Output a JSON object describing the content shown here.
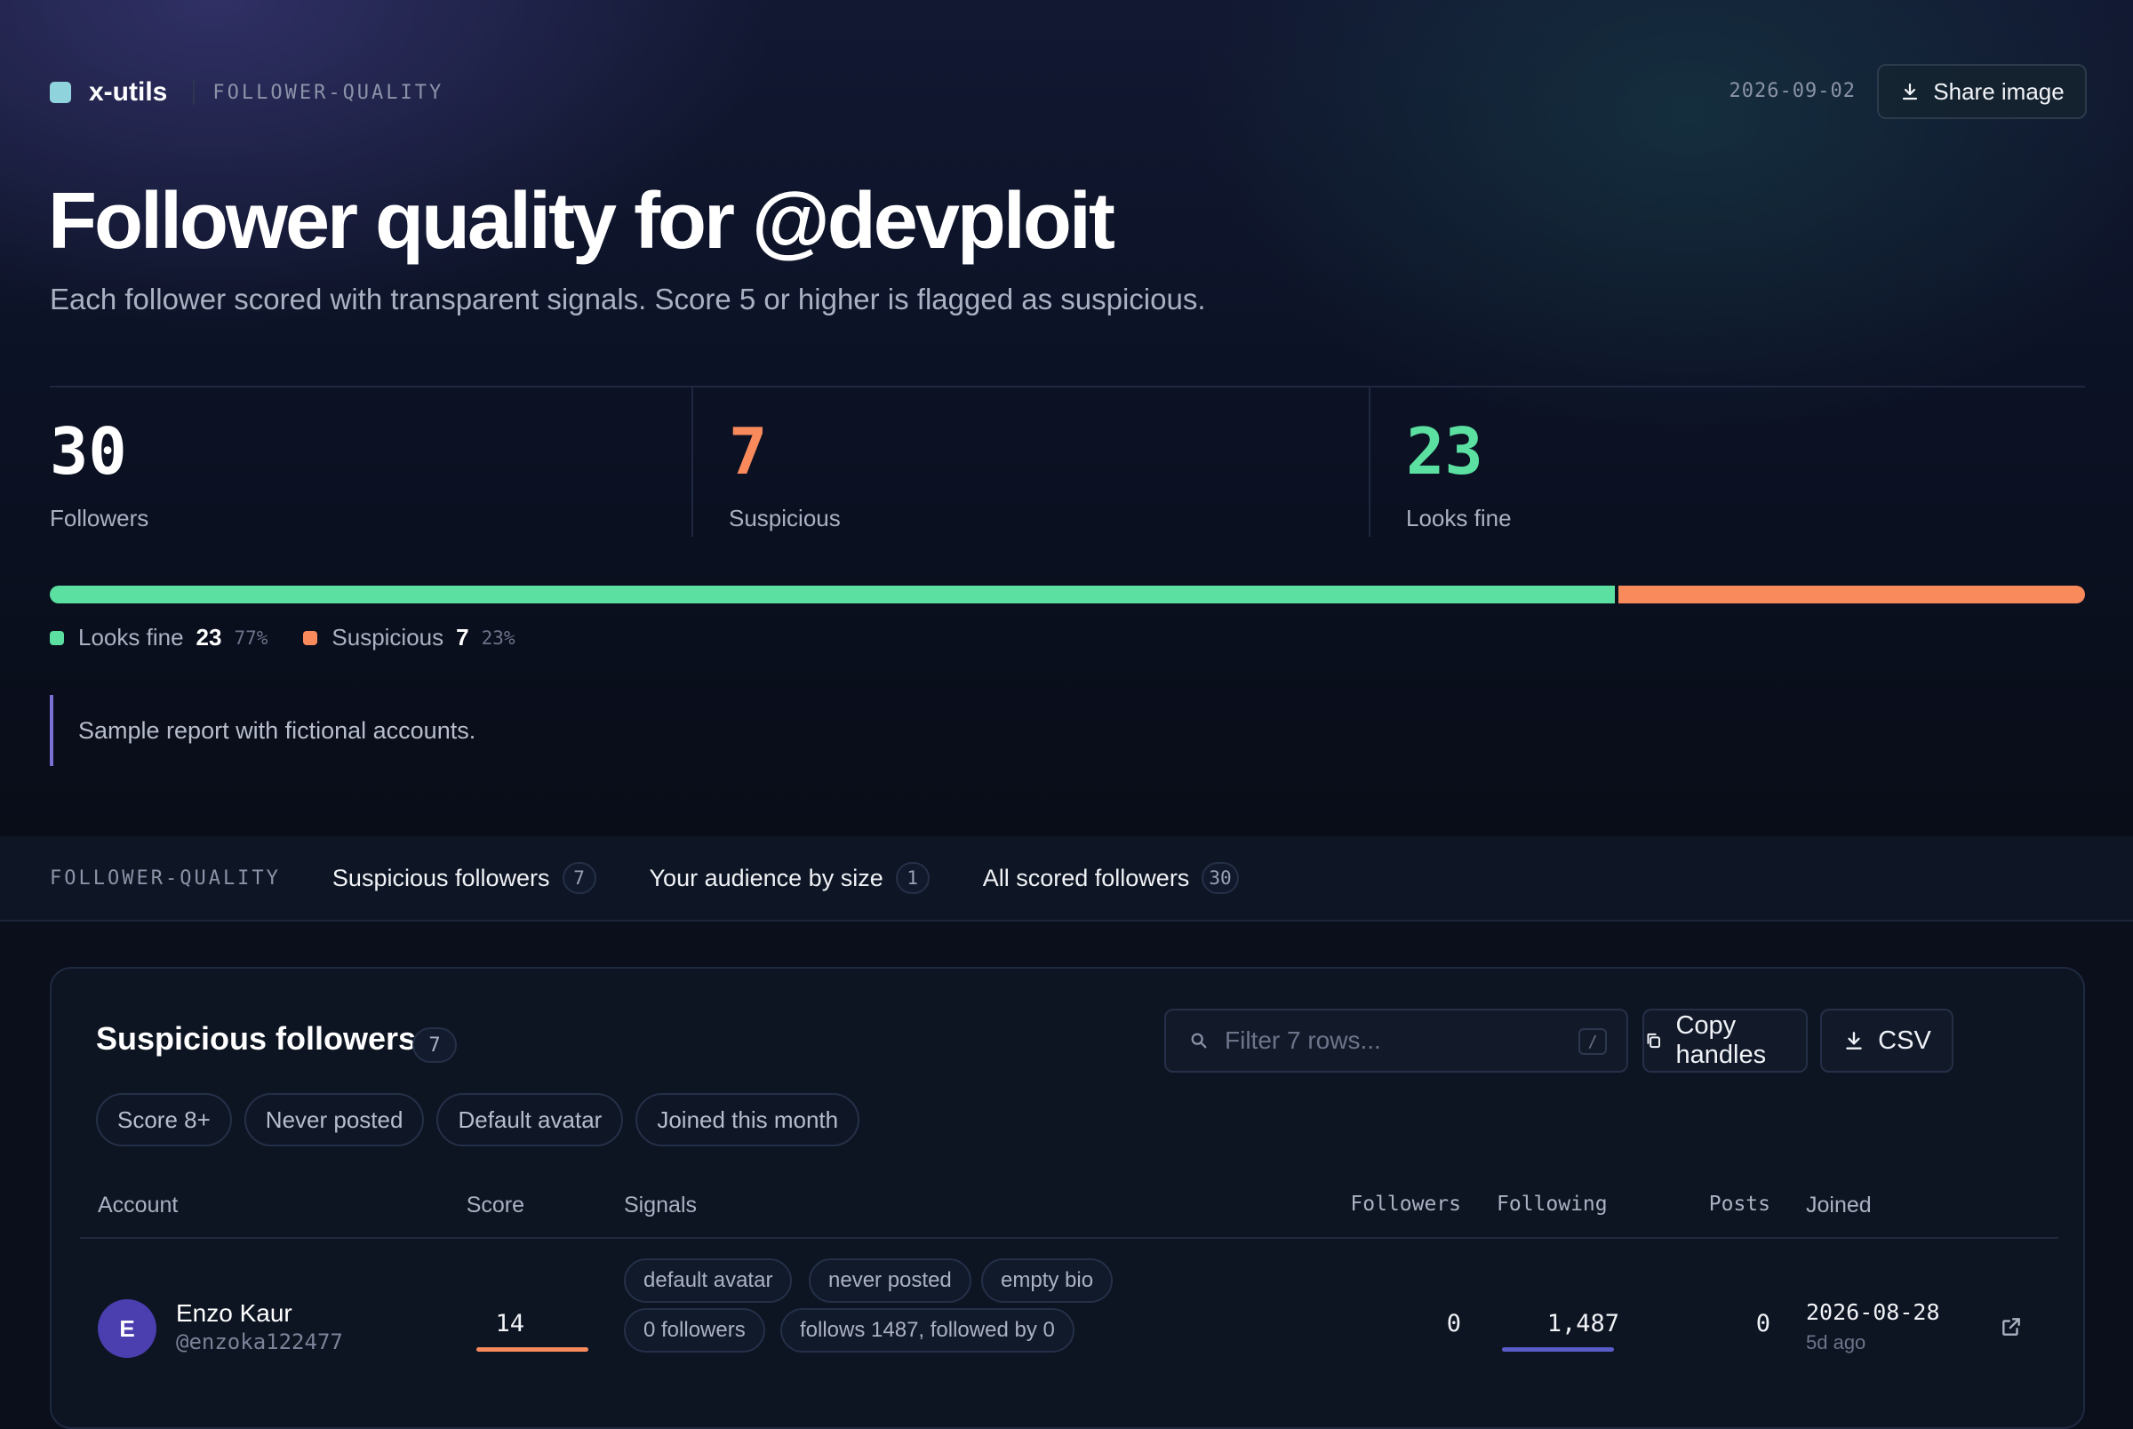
{
  "app": {
    "name": "x-utils",
    "section": "FOLLOWER-QUALITY",
    "accent": "#8fd3dd"
  },
  "header": {
    "date": "2026-09-02",
    "share_label": "Share image"
  },
  "title": "Follower quality for @devploit",
  "subtitle": "Each follower scored with transparent signals. Score 5 or higher is flagged as suspicious.",
  "stats": {
    "followers": {
      "value": "30",
      "label": "Followers"
    },
    "suspicious": {
      "value": "7",
      "label": "Suspicious",
      "color": "#f98a5c"
    },
    "fine": {
      "value": "23",
      "label": "Looks fine",
      "color": "#5be0a1"
    }
  },
  "breakdown": {
    "fine_fraction": 0.77,
    "suspicious_fraction": 0.23,
    "fine_label": "Looks fine",
    "fine_count": "23",
    "fine_pct": "77%",
    "suspicious_label": "Suspicious",
    "suspicious_count": "7",
    "suspicious_pct": "23%"
  },
  "note": "Sample report with fictional accounts.",
  "tabs": {
    "section": "FOLLOWER-QUALITY",
    "items": [
      {
        "label": "Suspicious followers",
        "count": "7"
      },
      {
        "label": "Your audience by size",
        "count": "1"
      },
      {
        "label": "All scored followers",
        "count": "30"
      }
    ]
  },
  "card": {
    "title": "Suspicious followers",
    "count": "7",
    "filter_placeholder": "Filter 7 rows...",
    "filter_shortcut": "/",
    "copy_label": "Copy handles",
    "csv_label": "CSV",
    "chips": [
      "Score 8+",
      "Never posted",
      "Default avatar",
      "Joined this month"
    ],
    "columns": {
      "account": "Account",
      "score": "Score",
      "signals": "Signals",
      "followers": "Followers",
      "following": "Following",
      "posts": "Posts",
      "joined": "Joined"
    },
    "rows": [
      {
        "initial": "E",
        "name": "Enzo Kaur",
        "handle": "@enzoka122477",
        "score": "14",
        "score_fraction": 1.0,
        "signals": [
          "default avatar",
          "never posted",
          "empty bio",
          "0 followers",
          "follows 1487, followed by 0"
        ],
        "followers": "0",
        "following": "1,487",
        "following_fraction": 1.0,
        "posts": "0",
        "joined": "2026-08-28",
        "joined_ago": "5d ago"
      }
    ]
  }
}
